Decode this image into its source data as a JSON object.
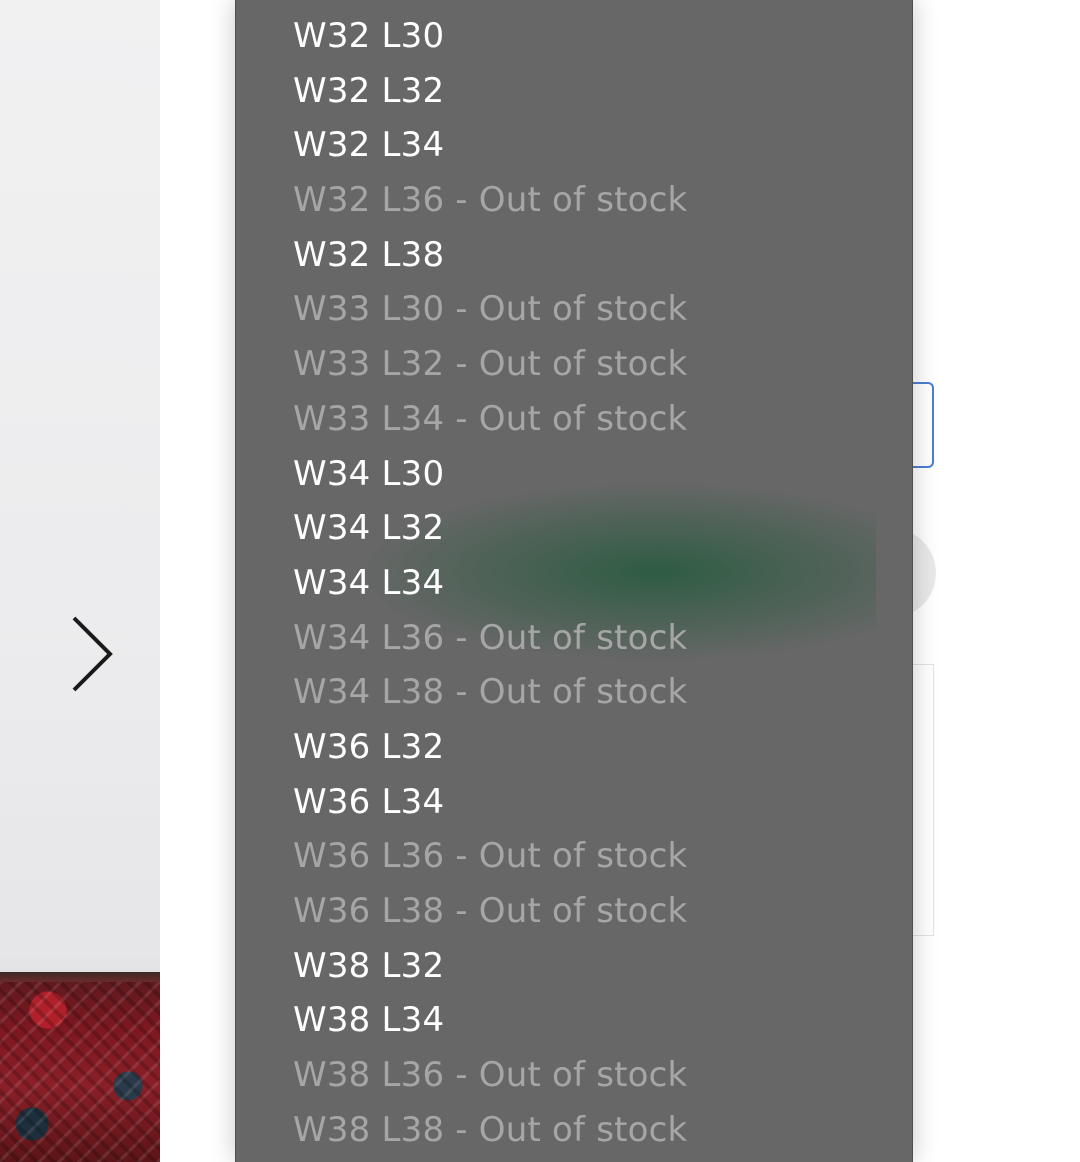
{
  "size_options": [
    {
      "label": "W32 L30",
      "out_of_stock": false
    },
    {
      "label": "W32 L32",
      "out_of_stock": false
    },
    {
      "label": "W32 L34",
      "out_of_stock": false
    },
    {
      "label": "W32 L36 - Out of stock",
      "out_of_stock": true
    },
    {
      "label": "W32 L38",
      "out_of_stock": false
    },
    {
      "label": "W33 L30 - Out of stock",
      "out_of_stock": true
    },
    {
      "label": "W33 L32 - Out of stock",
      "out_of_stock": true
    },
    {
      "label": "W33 L34 - Out of stock",
      "out_of_stock": true
    },
    {
      "label": "W34 L30",
      "out_of_stock": false
    },
    {
      "label": "W34 L32",
      "out_of_stock": false
    },
    {
      "label": "W34 L34",
      "out_of_stock": false
    },
    {
      "label": "W34 L36 - Out of stock",
      "out_of_stock": true
    },
    {
      "label": "W34 L38 - Out of stock",
      "out_of_stock": true
    },
    {
      "label": "W36 L32",
      "out_of_stock": false
    },
    {
      "label": "W36 L34",
      "out_of_stock": false
    },
    {
      "label": "W36 L36 - Out of stock",
      "out_of_stock": true
    },
    {
      "label": "W36 L38 - Out of stock",
      "out_of_stock": true
    },
    {
      "label": "W38 L32",
      "out_of_stock": false
    },
    {
      "label": "W38 L34",
      "out_of_stock": false
    },
    {
      "label": "W38 L36 - Out of stock",
      "out_of_stock": true
    },
    {
      "label": "W38 L38 - Out of stock",
      "out_of_stock": true
    }
  ],
  "colors": {
    "dropdown_background": "#676767",
    "option_text": "#ffffff",
    "option_disabled_text": "#a6a6a6",
    "focus_border": "#4a7fd4",
    "highlight_glow": "#245a3c"
  },
  "icons": {
    "next_arrow": "chevron-right-icon"
  }
}
